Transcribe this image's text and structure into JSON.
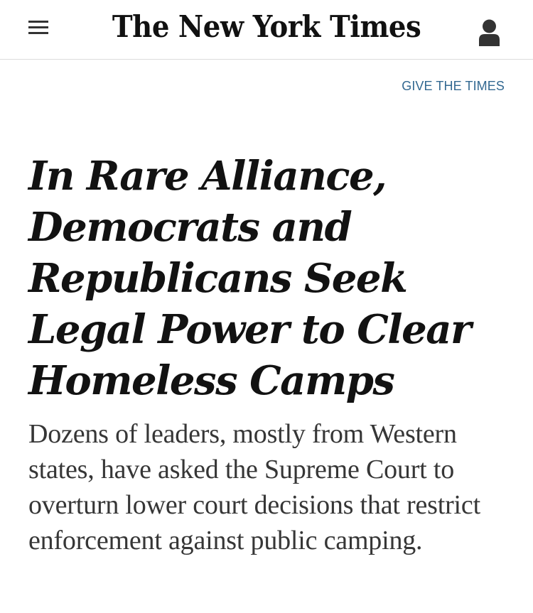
{
  "header": {
    "menu_icon": "hamburger-menu-icon",
    "logo_text": "The New York Times",
    "account_icon": "user-account-icon"
  },
  "promo": {
    "give_label": "GIVE THE TIMES",
    "give_color": "#326891"
  },
  "article": {
    "headline": "In Rare Alliance, Democrats and Republicans Seek Legal Power to Clear Homeless Camps",
    "summary": "Dozens of leaders, mostly from Western states, have asked the Supreme Court to overturn lower court decisions that restrict enforcement against public camping."
  }
}
